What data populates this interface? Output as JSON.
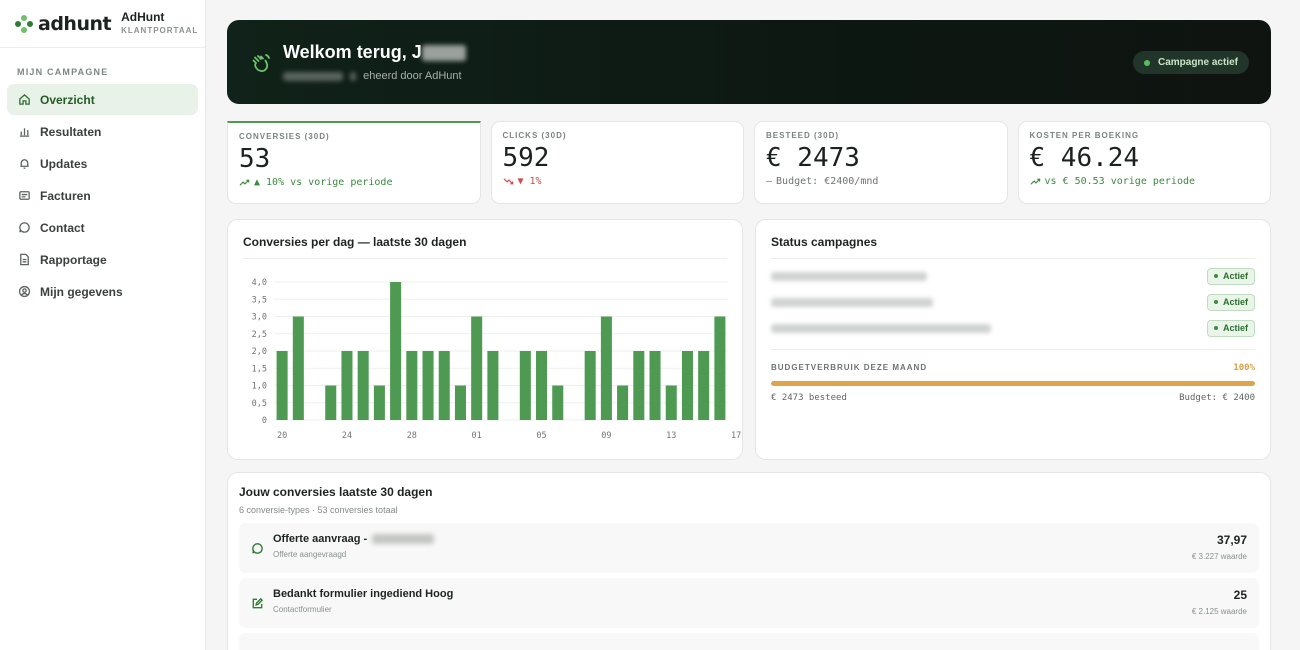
{
  "brand": {
    "logo_text": "adhunt",
    "name": "AdHunt",
    "subtitle": "KLANTPORTAAL"
  },
  "sidebar": {
    "section": "MIJN CAMPAGNE",
    "items": [
      {
        "label": "Overzicht",
        "icon": "home-icon",
        "active": true
      },
      {
        "label": "Resultaten",
        "icon": "bar-chart-icon"
      },
      {
        "label": "Updates",
        "icon": "bell-icon"
      },
      {
        "label": "Facturen",
        "icon": "invoice-icon"
      },
      {
        "label": "Contact",
        "icon": "chat-icon"
      },
      {
        "label": "Rapportage",
        "icon": "document-icon"
      },
      {
        "label": "Mijn gegevens",
        "icon": "user-circle-icon"
      }
    ]
  },
  "hero": {
    "title": "Welkom terug, J",
    "subtitle_suffix": "eheerd door AdHunt",
    "badge": "Campagne actief",
    "icon": "waving-hand-icon"
  },
  "kpis": [
    {
      "label": "CONVERSIES (30D)",
      "value": "53",
      "delta_marker": "▲",
      "delta": "10% vs vorige periode",
      "trend": "up"
    },
    {
      "label": "CLICKS (30D)",
      "value": "592",
      "delta_marker": "▼",
      "delta": "1%",
      "trend": "down"
    },
    {
      "label": "BESTEED (30D)",
      "value": "€ 2473",
      "delta_marker": "—",
      "delta": "Budget: €2400/mnd",
      "trend": "flat"
    },
    {
      "label": "KOSTEN PER BOEKING",
      "value": "€ 46.24",
      "delta_marker": "",
      "delta": "vs € 50.53 vorige periode",
      "trend": "up"
    }
  ],
  "chart_card": {
    "title": "Conversies per dag — laatste 30 dagen"
  },
  "chart_data": {
    "type": "bar",
    "title": "Conversies per dag — laatste 30 dagen",
    "xlabel": "",
    "ylabel": "",
    "ylim": [
      0,
      4
    ],
    "yticks": [
      "0",
      "0,5",
      "1,0",
      "1,5",
      "2,0",
      "2,5",
      "3,0",
      "3,5",
      "4,0"
    ],
    "x_tick_labels": [
      "20",
      "24",
      "28",
      "01",
      "05",
      "09",
      "13",
      "17"
    ],
    "x_tick_index": [
      0,
      4,
      8,
      12,
      16,
      20,
      24,
      28
    ],
    "values": [
      2,
      3,
      0,
      1,
      2,
      2,
      1,
      4,
      2,
      2,
      2,
      1,
      3,
      2,
      0,
      2,
      2,
      1,
      0,
      2,
      3,
      1,
      2,
      2,
      1,
      2,
      2,
      3
    ],
    "color": "#4e9a52",
    "grid": true
  },
  "status": {
    "title": "Status campagnes",
    "campaigns": [
      {
        "badge": "Actief"
      },
      {
        "badge": "Actief"
      },
      {
        "badge": "Actief"
      }
    ],
    "budget_label": "BUDGETVERBRUIK DEZE MAAND",
    "budget_pct": "100%",
    "budget_fraction": 1.0,
    "spent": "€ 2473 besteed",
    "budget": "Budget: € 2400"
  },
  "conversions": {
    "title": "Jouw conversies laatste 30 dagen",
    "subtitle": "6 conversie-types · 53 conversies totaal",
    "items": [
      {
        "name": "Offerte aanvraag -",
        "type": "Offerte aangevraagd",
        "value": "37,97",
        "worth": "€ 3.227 waarde",
        "icon": "chat-bubble-icon"
      },
      {
        "name": "Bedankt formulier ingediend Hoog",
        "type": "Contactformulier",
        "value": "25",
        "worth": "€ 2.125 waarde",
        "icon": "edit-form-icon"
      }
    ]
  },
  "colors": {
    "accent": "#4e9a52",
    "hero_bg": "#0f1a14",
    "budget": "#dea44a",
    "down": "#d24848"
  }
}
